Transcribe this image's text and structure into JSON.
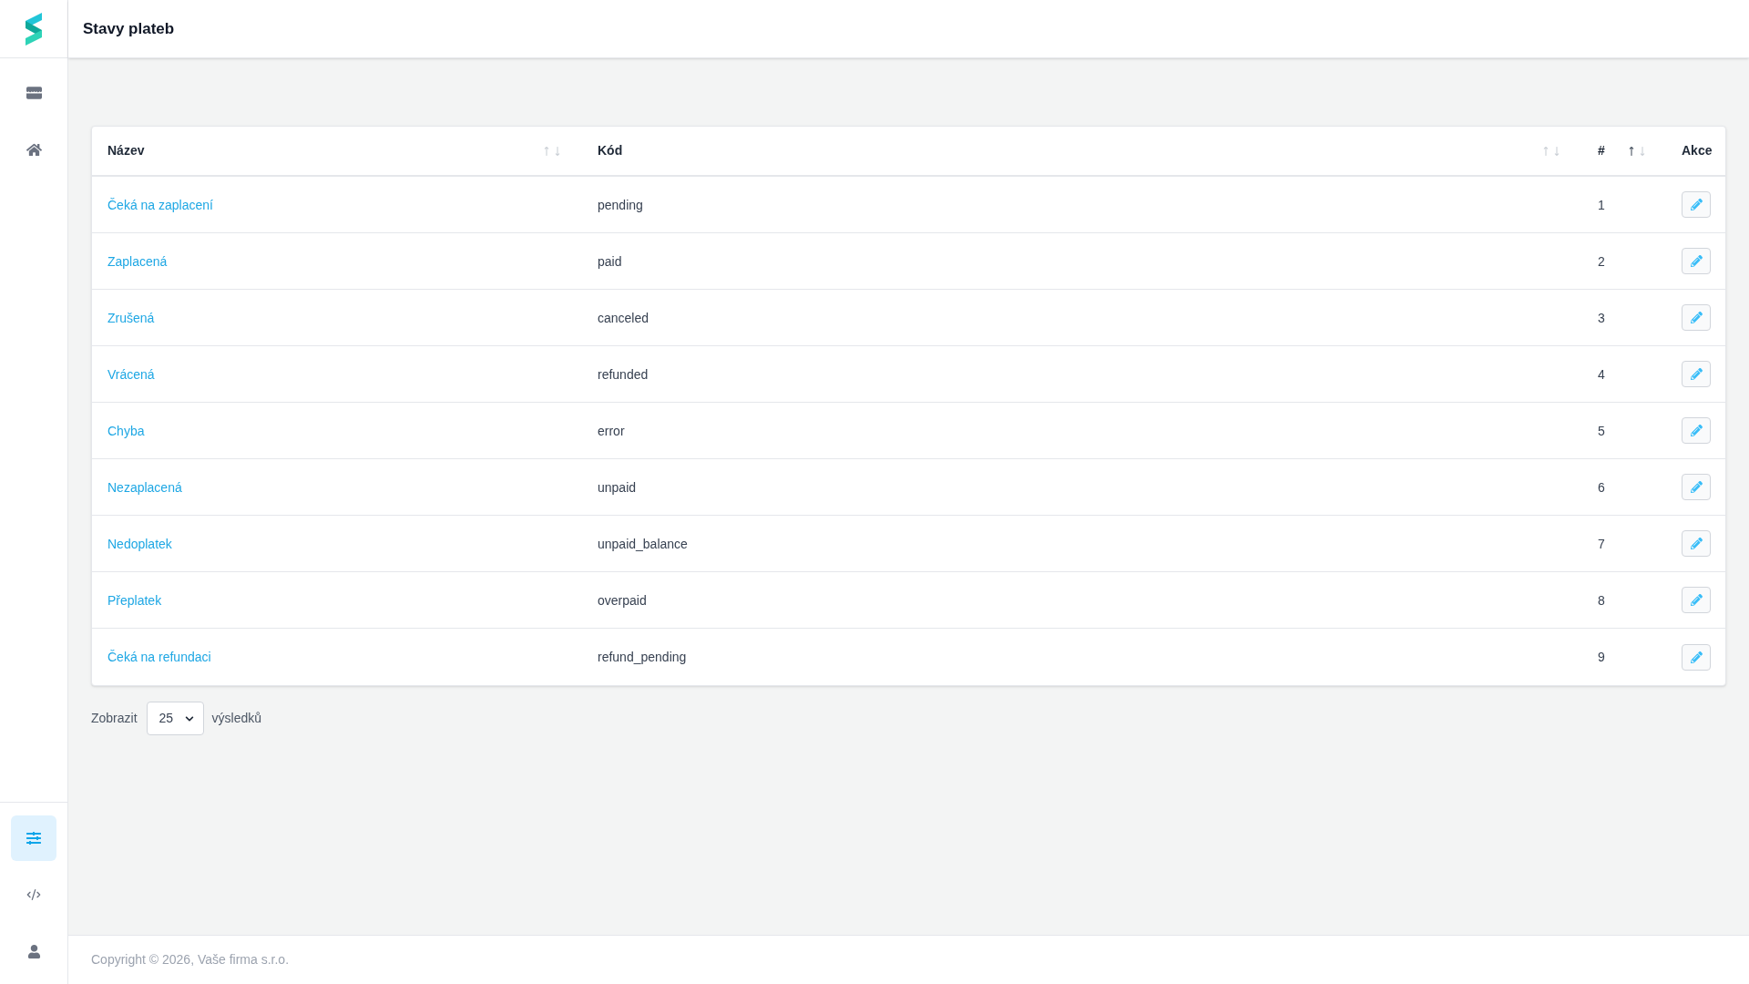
{
  "sidebar": {
    "top_items": [
      {
        "selected": false
      },
      {
        "selected": false
      }
    ],
    "bottom_items": [
      {
        "selected": true
      },
      {
        "selected": false
      },
      {
        "selected": false
      }
    ]
  },
  "header": {
    "title": "Stavy plateb"
  },
  "table": {
    "columns": [
      {
        "label": "Název",
        "sorted_ascending": false
      },
      {
        "label": "Kód",
        "sorted_ascending": false
      },
      {
        "label": "#",
        "sorted_ascending": true
      },
      {
        "label": "Akce"
      }
    ],
    "rows": [
      {
        "name": "Čeká na zaplacení",
        "code": "pending",
        "number": "1"
      },
      {
        "name": "Zaplacená",
        "code": "paid",
        "number": "2"
      },
      {
        "name": "Zrušená",
        "code": "canceled",
        "number": "3"
      },
      {
        "name": "Vrácená",
        "code": "refunded",
        "number": "4"
      },
      {
        "name": "Chyba",
        "code": "error",
        "number": "5"
      },
      {
        "name": "Nezaplacená",
        "code": "unpaid",
        "number": "6"
      },
      {
        "name": "Nedoplatek",
        "code": "unpaid_balance",
        "number": "7"
      },
      {
        "name": "Přeplatek",
        "code": "overpaid",
        "number": "8"
      },
      {
        "name": "Čeká na refundaci",
        "code": "refund_pending",
        "number": "9"
      }
    ]
  },
  "pagination": {
    "label_before": "Zobrazit",
    "page_size": "25",
    "label_after": "výsledků"
  },
  "footer": {
    "copyright": "Copyright © 2026, Vaše firma s.r.o."
  }
}
